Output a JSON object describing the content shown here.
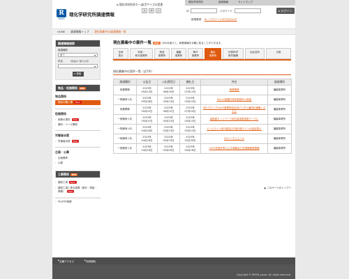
{
  "header": {
    "logo_letter": "R",
    "logo_text": "RIKEN",
    "site_title": "理化学研究所調達情報",
    "links": [
      "理化学研究所ホーム",
      "文字サイズの変更"
    ],
    "font_sizes": [
      "大",
      "中",
      "小"
    ],
    "topnav": [
      "理化学研究所",
      "調達情報",
      "サイトマップ"
    ],
    "id_label": "ID",
    "password_label": "パスワード",
    "login_label": "ログイン",
    "help_text": "新規登録",
    "help_link": "ID・パスワードをお忘れの方"
  },
  "breadcrumb": [
    "HOME",
    "調達情報トップ",
    "現在募集中の調達情報一覧"
  ],
  "sidebar": {
    "search": {
      "title": "調達情報検索",
      "type_label": "調達種別",
      "type_value": "全て",
      "keyword_label": "件名",
      "keyword_hint": "（件名の一部でも可）",
      "button": "検索"
    },
    "goods": {
      "title": "物品・役務関係",
      "rss": "RSS",
      "sections": [
        {
          "heading": "物品関係",
          "items": [
            {
              "label": "物品の購入等",
              "new": "New",
              "active": true
            }
          ]
        },
        {
          "heading": "役務関係",
          "items": [
            {
              "label": "役務の提供",
              "new": "New"
            },
            {
              "label": "借料・リース関係",
              "new": ""
            }
          ]
        },
        {
          "heading": "労働者派遣",
          "items": [
            {
              "label": "労働者派遣",
              "new": "New"
            }
          ]
        },
        {
          "heading": "企画・公募",
          "items": [
            {
              "label": "企画競争",
              "new": ""
            },
            {
              "label": "公募",
              "new": ""
            }
          ]
        }
      ]
    },
    "works": {
      "title": "工事関係",
      "rss": "RSS",
      "items": [
        {
          "label": "建設工事",
          "new": "New"
        },
        {
          "label": "建設工事に係る役務（設計・測量・調査）",
          "new": "New"
        }
      ],
      "pdf": "PFI/PPP事業"
    }
  },
  "main": {
    "title": "現在募集中の案件一覧",
    "rss": "RSS",
    "note": "RSSを使うと、新着情報を手軽に知ることができます。",
    "tabs": [
      "全体\n表示",
      "本部・\n和光事業所",
      "筑波\n事業所",
      "播磨\n事業所",
      "神戸\n事業所",
      "横浜\n事業所",
      "計算科学\n研究機構",
      "仙台支所",
      "大阪"
    ],
    "active_tab": 5,
    "list_heading": "現在募集中の案件一覧（全7件）",
    "columns": [
      "調達種別",
      "公告日",
      "入札締切日",
      "開札日",
      "件名",
      "調達場所"
    ],
    "rows": [
      [
        "役務関係",
        "2023年\n05月10日",
        "2023年\n06月30日",
        "2023年\n07月13日",
        "清掃業務",
        "播磨事業所"
      ],
      [
        "一般競争入札",
        "2023年\n05月08日",
        "2023年\n05月23日",
        "2023年\n05月23日",
        "SACLA装置冷却系制御PLC部品",
        "播磨事業所"
      ],
      [
        "役務関係",
        "2023年\n05月02日",
        "2023年\n06月22日",
        "2023年\n07月04日",
        "SBCクロックGenP事業所総合用デジタル通用化通機システム",
        "播磨事業所"
      ],
      [
        "一般競争入札",
        "2023年\n05月01日",
        "2023年\n05月23日",
        "2023年\n05月23日",
        "高精度ネットワーク用計量用周波数テーブル",
        "播磨事業所"
      ],
      [
        "一般競争入札",
        "2023年\n04月28日",
        "2023年\n05月19日",
        "2023年\n05月22日",
        "ビームライン用Si製及びSi製2個ラインの品目揃え",
        "播磨事業所"
      ],
      [
        "一般競争入札",
        "2023年\n04月28日",
        "2023年\n05月19日",
        "2023年\n05月30日",
        "LDバーモジュール",
        "播磨事業所"
      ],
      [
        "一般競争入札",
        "2023年\n04月18日",
        "2023年\n05月09日",
        "2023年\n05月18日",
        "2023年度冬季以上冷凍機及び空調機器等整備",
        "播磨事業所"
      ]
    ],
    "pagetop": "このページのトップへ"
  },
  "footer": {
    "links": [
      "交通アクセス",
      "利用規約"
    ],
    "copyright": "Copyright © RIKEN, Japan. All rights reserved."
  },
  "colors": {
    "accent": "#e05a10",
    "dark": "#4a4a4a",
    "new": "#d81818",
    "logo": "#0b5aa5"
  }
}
